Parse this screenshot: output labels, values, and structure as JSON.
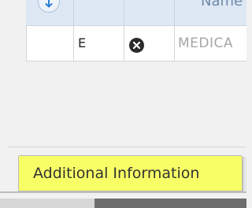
{
  "grid": {
    "header": {
      "name_label": "Name"
    },
    "row": {
      "code": "E",
      "description": "MEDICA"
    },
    "icons": {
      "sort": "sort-down-icon",
      "remove": "close-circle-icon"
    }
  },
  "tabs": {
    "active_label": "Additional Information",
    "highlight_color": "#f8ff66"
  }
}
